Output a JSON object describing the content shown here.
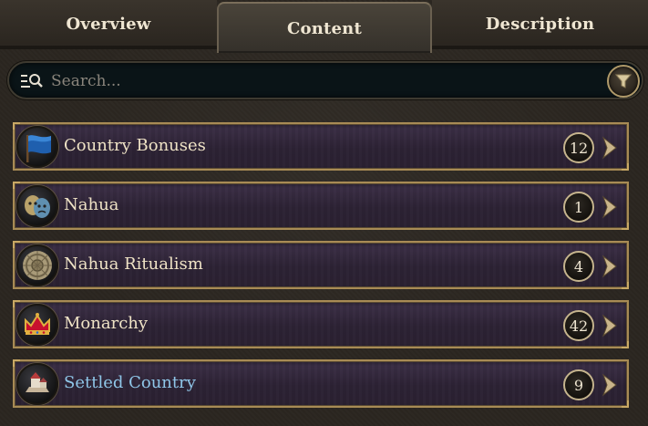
{
  "tabs": [
    {
      "label": "Overview",
      "active": false
    },
    {
      "label": "Content",
      "active": true
    },
    {
      "label": "Description",
      "active": false
    }
  ],
  "search": {
    "placeholder": "Search...",
    "value": "",
    "icon": "search-list-icon",
    "filter_icon": "funnel-icon"
  },
  "items": [
    {
      "label": "Country Bonuses",
      "count": "12",
      "icon": "blue-flag-icon",
      "highlight": false
    },
    {
      "label": "Nahua",
      "count": "1",
      "icon": "theatre-masks-icon",
      "highlight": false
    },
    {
      "label": "Nahua Ritualism",
      "count": "4",
      "icon": "aztec-calendar-icon",
      "highlight": false
    },
    {
      "label": "Monarchy",
      "count": "42",
      "icon": "crown-icon",
      "highlight": false
    },
    {
      "label": "Settled Country",
      "count": "9",
      "icon": "settlement-icon",
      "highlight": true
    }
  ],
  "colors": {
    "accent_gold": "#c5b48d",
    "row_background": "#2c2234",
    "link_blue": "#8fc6e8",
    "text_cream": "#efe3c6"
  }
}
